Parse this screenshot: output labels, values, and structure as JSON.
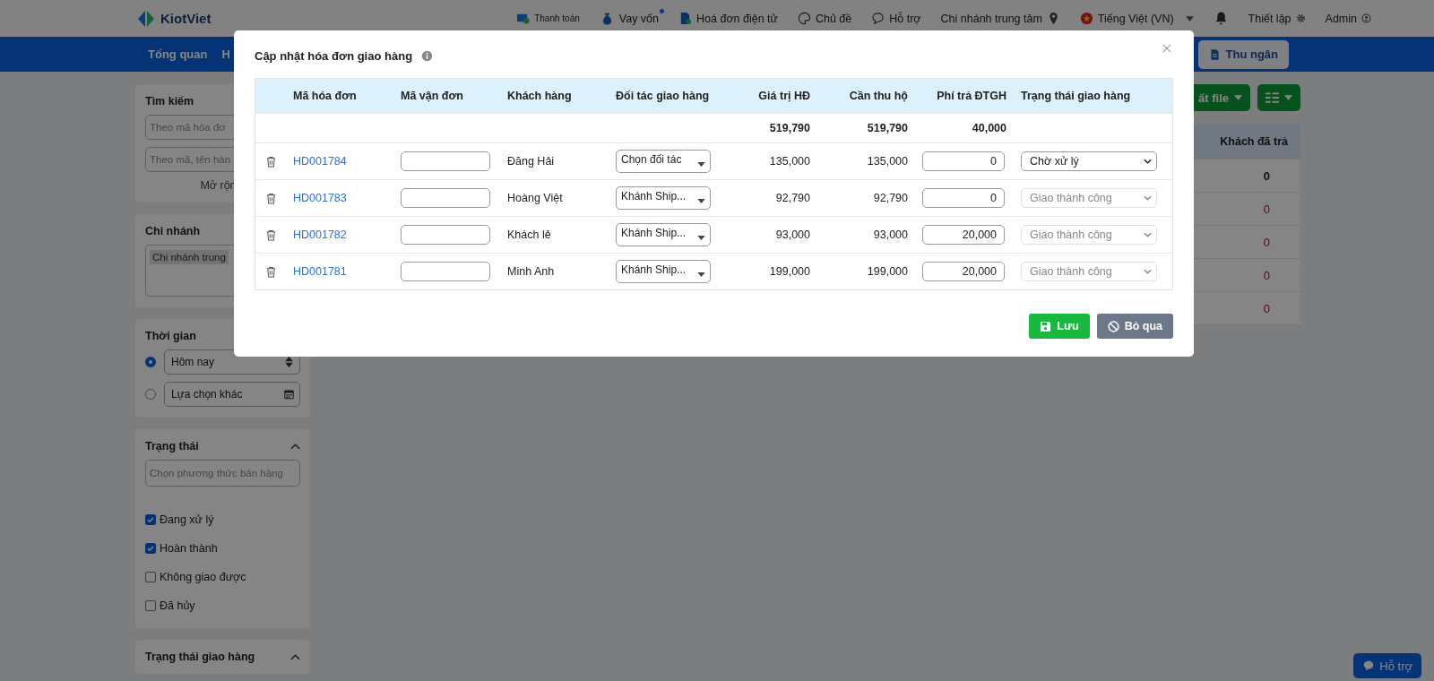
{
  "top_bar": {
    "logo": "KiotViet",
    "items": [
      {
        "kind": "payment",
        "label": "Thanh toán"
      },
      {
        "kind": "loan",
        "label": "Vay vốn",
        "new_badge": true
      },
      {
        "kind": "invoice",
        "label": "Hoá đơn điện tử"
      },
      {
        "kind": "theme",
        "label": "Chủ đề"
      },
      {
        "kind": "support",
        "label": "Hỗ trợ"
      },
      {
        "kind": "branch",
        "label": "Chi nhánh trung tâm"
      },
      {
        "kind": "language",
        "label": "Tiếng Việt (VN)"
      },
      {
        "kind": "bell"
      },
      {
        "kind": "settings",
        "label": "Thiết lập"
      },
      {
        "kind": "account",
        "label": "Admin"
      }
    ]
  },
  "nav": {
    "items": [
      "Tổng quan",
      "H"
    ],
    "cashier_button": "Thu ngân"
  },
  "sidebar": {
    "search": {
      "title": "Tìm kiếm",
      "fields": [
        {
          "placeholder": "Theo mã hóa đơ"
        },
        {
          "placeholder": "Theo mã, tên hàn"
        }
      ],
      "more_link": "Mở rộn"
    },
    "branch": {
      "title": "Chi nhánh",
      "tag": "Chi nhánh trung"
    },
    "time": {
      "title": "Thời gian",
      "options": [
        {
          "kind": "select",
          "label": "Hôm nay",
          "selected": true
        },
        {
          "kind": "date",
          "label": "Lựa chọn khác",
          "selected": false
        }
      ]
    },
    "status": {
      "title": "Trạng thái",
      "expanded": true,
      "select_placeholder": "Chọn phương thức bán hàng",
      "checks": [
        {
          "label": "Đang xử lý",
          "checked": true
        },
        {
          "label": "Hoàn thành",
          "checked": true
        },
        {
          "label": "Không giao được",
          "checked": false
        },
        {
          "label": "Đã hủy",
          "checked": false
        }
      ]
    },
    "delivery_status": {
      "title": "Trạng thái giao hàng",
      "expanded": true
    }
  },
  "main": {
    "export_button": "ất file",
    "table": {
      "column": "Khách đã trả",
      "total": "0",
      "rows": [
        "0",
        "0",
        "0",
        "0"
      ]
    }
  },
  "help_button": "Hỗ trợ",
  "modal": {
    "title": "Cập nhật hóa đơn giao hàng",
    "columns": [
      "Mã hóa đơn",
      "Mã vận đơn",
      "Khách hàng",
      "Đối tác giao hàng",
      "Giá trị HĐ",
      "Cần thu hộ",
      "Phí trả ĐTGH",
      "Trạng thái giao hàng"
    ],
    "totals": {
      "invoice_value": "519,790",
      "cod": "519,790",
      "fee": "40,000"
    },
    "rows": [
      {
        "invoice": "HD001784",
        "customer": "Đăng Hải",
        "partner": "Chọn đối tác",
        "invoice_value": "135,000",
        "cod": "135,000",
        "fee": "0",
        "status": "Chờ xử lý",
        "status_disabled": false
      },
      {
        "invoice": "HD001783",
        "customer": "Hoàng Việt",
        "partner": "Khánh Ship...",
        "invoice_value": "92,790",
        "cod": "92,790",
        "fee": "0",
        "status": "Giao thành công",
        "status_disabled": true
      },
      {
        "invoice": "HD001782",
        "customer": "Khách lẻ",
        "partner": "Khánh Ship...",
        "invoice_value": "93,000",
        "cod": "93,000",
        "fee": "20,000",
        "status": "Giao thành công",
        "status_disabled": true
      },
      {
        "invoice": "HD001781",
        "customer": "Minh Anh",
        "partner": "Khánh Ship...",
        "invoice_value": "199,000",
        "cod": "199,000",
        "fee": "20,000",
        "status": "Giao thành công",
        "status_disabled": true
      }
    ],
    "save_button": "Lưu",
    "cancel_button": "Bỏ qua"
  }
}
